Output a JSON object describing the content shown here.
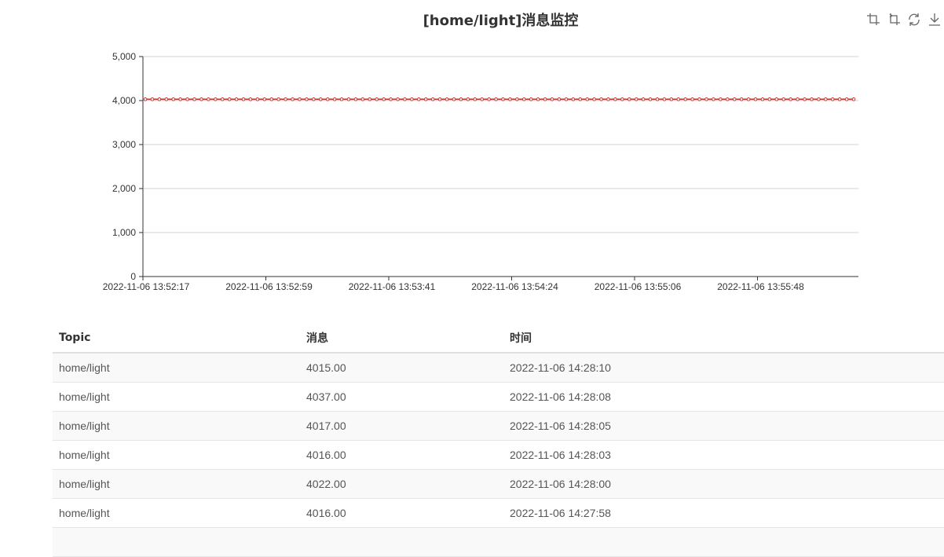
{
  "chart": {
    "title": "[home/light]消息监控",
    "toolbox": [
      {
        "name": "zoom-icon",
        "label": "区域缩放"
      },
      {
        "name": "zoom-reset-icon",
        "label": "区域缩放还原"
      },
      {
        "name": "refresh-icon",
        "label": "还原"
      },
      {
        "name": "download-icon",
        "label": "保存为图片"
      }
    ]
  },
  "chart_data": {
    "type": "line",
    "ylim": [
      0,
      5000
    ],
    "yticks": [
      "0",
      "1,000",
      "2,000",
      "3,000",
      "4,000",
      "5,000"
    ],
    "xticks": [
      "2022-11-06 13:52:17",
      "2022-11-06 13:52:59",
      "2022-11-06 13:53:41",
      "2022-11-06 13:54:24",
      "2022-11-06 13:55:06",
      "2022-11-06 13:55:48"
    ],
    "color": "#c23531",
    "values": [
      4030,
      4030,
      4030,
      4030,
      4030,
      4030,
      4030,
      4030,
      4030,
      4030,
      4030,
      4030,
      4030,
      4030,
      4030,
      4030,
      4030,
      4030,
      4030,
      4030,
      4030,
      4030,
      4030,
      4030,
      4030,
      4030,
      4030,
      4030,
      4030,
      4030,
      4030,
      4030,
      4030,
      4030,
      4030,
      4030,
      4030,
      4030,
      4030,
      4030,
      4030,
      4030,
      4030,
      4030,
      4030,
      4030,
      4030,
      4030,
      4030,
      4030,
      4030,
      4030,
      4030,
      4030,
      4030,
      4030,
      4030,
      4030,
      4030,
      4030,
      4030,
      4030,
      4030,
      4030,
      4030,
      4030,
      4030,
      4030,
      4030,
      4030,
      4030,
      4030,
      4030,
      4030,
      4030,
      4030,
      4030,
      4030,
      4030,
      4030,
      4030,
      4030,
      4030,
      4030,
      4030,
      4030,
      4030,
      4030,
      4030,
      4030,
      4030,
      4030,
      4030,
      4030,
      4030,
      4030,
      4030,
      4030,
      4030,
      4030,
      4030,
      4030
    ]
  },
  "table": {
    "headers": [
      "Topic",
      "消息",
      "时间"
    ],
    "rows": [
      [
        "home/light",
        "4015.00",
        "2022-11-06 14:28:10"
      ],
      [
        "home/light",
        "4037.00",
        "2022-11-06 14:28:08"
      ],
      [
        "home/light",
        "4017.00",
        "2022-11-06 14:28:05"
      ],
      [
        "home/light",
        "4016.00",
        "2022-11-06 14:28:03"
      ],
      [
        "home/light",
        "4022.00",
        "2022-11-06 14:28:00"
      ],
      [
        "home/light",
        "4016.00",
        "2022-11-06 14:27:58"
      ],
      [
        "",
        "",
        ""
      ]
    ]
  }
}
